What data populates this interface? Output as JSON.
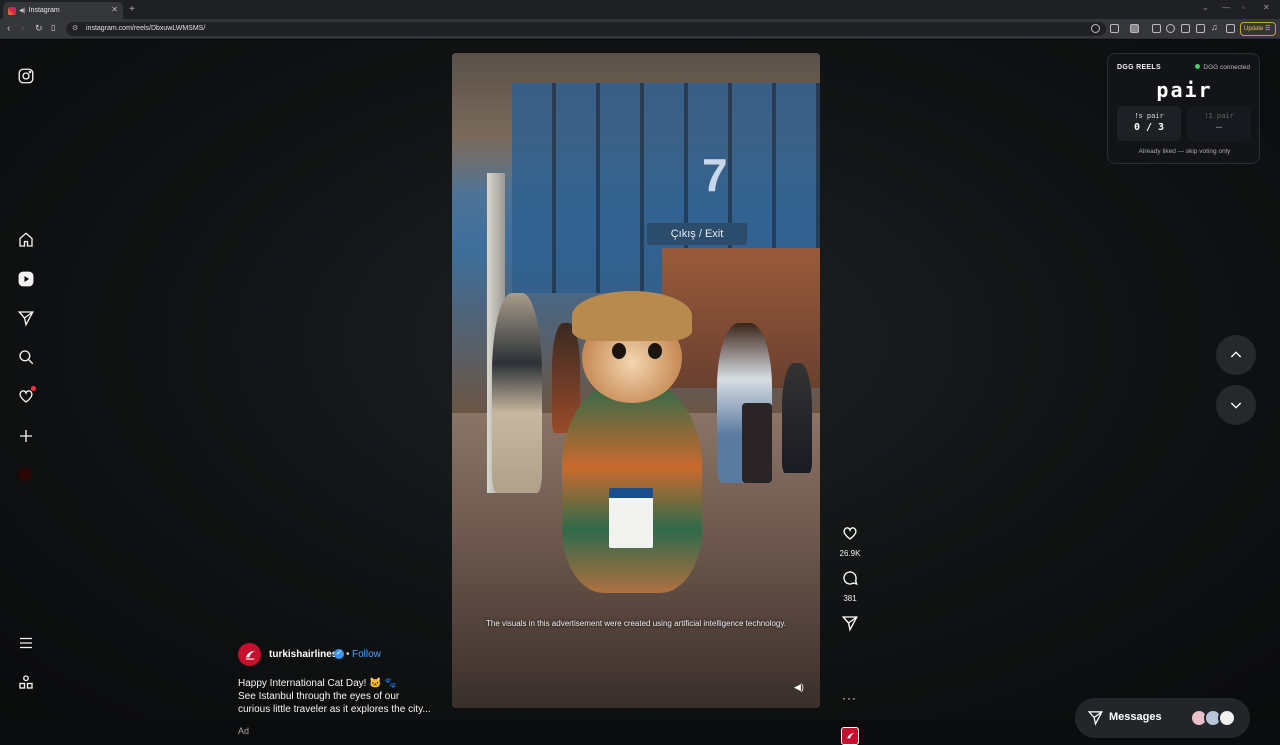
{
  "browser": {
    "tab_title": "Instagram",
    "tab_close": "✕",
    "new_tab": "+",
    "url": "instagram.com/reels/DbxuwLWMSMS/",
    "update_label": "Update"
  },
  "sidebar": {
    "items": [
      {
        "name": "instagram-logo-icon"
      },
      {
        "name": "home-icon"
      },
      {
        "name": "reels-icon"
      },
      {
        "name": "direct-send-icon"
      },
      {
        "name": "search-icon"
      },
      {
        "name": "notifications-heart-icon"
      },
      {
        "name": "create-plus-icon"
      },
      {
        "name": "profile-avatar"
      },
      {
        "name": "menu-icon"
      },
      {
        "name": "more-apps-icon"
      }
    ]
  },
  "reel": {
    "ai_disclaimer": "The visuals in this advertisement were created using artificial intelligence technology.",
    "username": "turkishairlines",
    "verified_mark": "✓",
    "separator": "•",
    "follow_label": "Follow",
    "caption": "Happy International Cat Day! 🐱 🐾\nSee Istanbul through the eyes of our\ncurious little traveler as it explores the city...",
    "ad_label": "Ad",
    "sign_number": "7",
    "exit_sign": "Çıkış / Exit"
  },
  "actions": {
    "likes": "26.9K",
    "comments": "381",
    "more": "···"
  },
  "dgg_panel": {
    "title": "DGG REELS",
    "status": "DGG connected",
    "status_color": "#3ecf6a",
    "word": "pair",
    "vote_yes_label": "!s pair",
    "vote_yes_value": "0 / 3",
    "vote_no_label": "!1 pair",
    "vote_no_value": "—",
    "footer": "Already liked — skip voting only"
  },
  "messages": {
    "label": "Messages"
  },
  "colors": {
    "accent_follow": "#4ea2ff",
    "brand_red": "#c8102e",
    "notification": "#ff3040"
  }
}
